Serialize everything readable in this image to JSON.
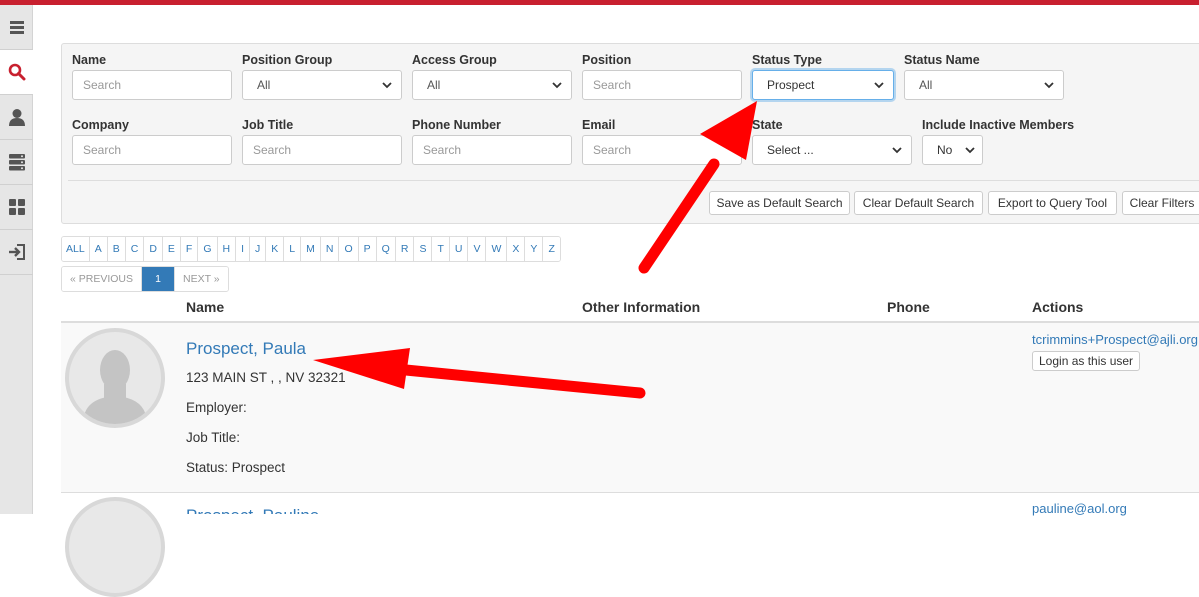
{
  "sidebar": {
    "items": [
      {
        "icon": "menu-icon"
      },
      {
        "icon": "search-icon",
        "active": true
      },
      {
        "icon": "user-icon"
      },
      {
        "icon": "server-icon"
      },
      {
        "icon": "dashboard-icon"
      },
      {
        "icon": "sign-in-icon"
      }
    ]
  },
  "filters": {
    "name": {
      "label": "Name",
      "placeholder": "Search"
    },
    "position_group": {
      "label": "Position Group",
      "value": "All"
    },
    "access_group": {
      "label": "Access Group",
      "value": "All"
    },
    "position": {
      "label": "Position",
      "placeholder": "Search"
    },
    "status_type": {
      "label": "Status Type",
      "value": "Prospect"
    },
    "status_name": {
      "label": "Status Name",
      "value": "All"
    },
    "company": {
      "label": "Company",
      "placeholder": "Search"
    },
    "job_title": {
      "label": "Job Title",
      "placeholder": "Search"
    },
    "phone_number": {
      "label": "Phone Number",
      "placeholder": "Search"
    },
    "email": {
      "label": "Email",
      "placeholder": "Search"
    },
    "state": {
      "label": "State",
      "value": "Select ..."
    },
    "include_inactive": {
      "label": "Include Inactive Members",
      "value": "No"
    }
  },
  "buttons": {
    "save_default": "Save as Default Search",
    "clear_default": "Clear Default Search",
    "export_query": "Export to Query Tool",
    "clear_filters": "Clear Filters"
  },
  "alphabet": [
    "ALL",
    "A",
    "B",
    "C",
    "D",
    "E",
    "F",
    "G",
    "H",
    "I",
    "J",
    "K",
    "L",
    "M",
    "N",
    "O",
    "P",
    "Q",
    "R",
    "S",
    "T",
    "U",
    "V",
    "W",
    "X",
    "Y",
    "Z"
  ],
  "pager": {
    "prev": "« PREVIOUS",
    "current": "1",
    "next": "NEXT »"
  },
  "table": {
    "headers": {
      "name": "Name",
      "other": "Other Information",
      "phone": "Phone",
      "actions": "Actions"
    },
    "rows": [
      {
        "name": "Prospect, Paula",
        "address": "123 MAIN ST , , NV 32321",
        "employer": "Employer:",
        "job_title": "Job Title:",
        "status": "Status: Prospect",
        "email": "tcrimmins+Prospect@ajli.org",
        "login": "Login as this user"
      },
      {
        "name": "Prospect, Pauline",
        "email": "pauline@aol.org"
      }
    ]
  },
  "colors": {
    "brand": "#c8202f",
    "link": "#337ab7",
    "annotation_arrow": "#ff0000"
  }
}
